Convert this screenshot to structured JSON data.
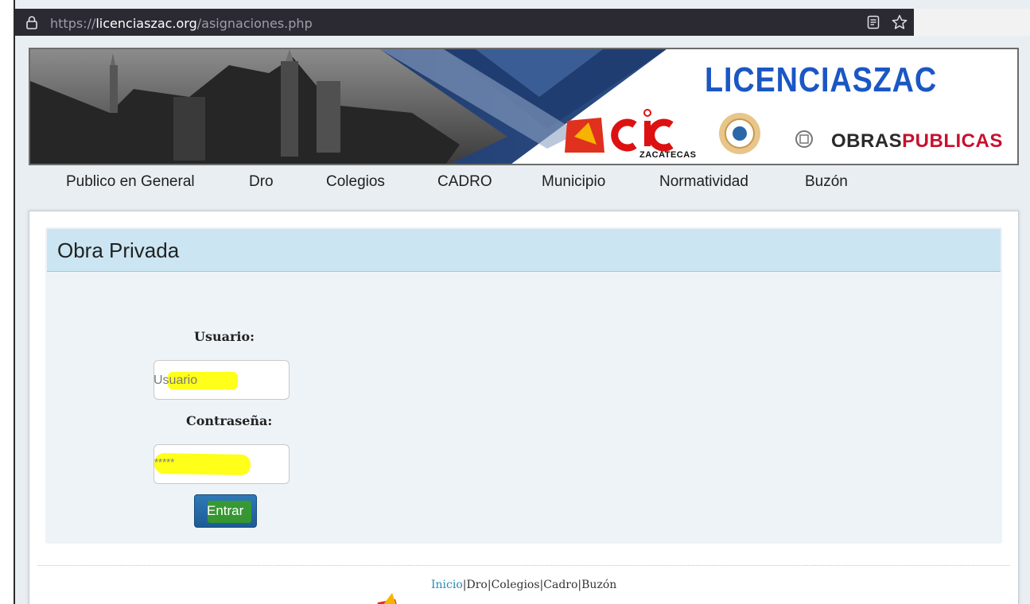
{
  "browser": {
    "url_protocol": "https://",
    "url_host": "licenciaszac.org",
    "url_path": "/asignaciones.php"
  },
  "banner": {
    "brand": "LICENCIASZAC",
    "zacatecas_label": "ZACATECAS",
    "obras_label_1": "OBRAS",
    "obras_label_2": "PUBLICAS"
  },
  "nav": {
    "items": [
      "Publico en General",
      "Dro",
      "Colegios",
      "CADRO",
      "Municipio",
      "Normatividad",
      "Buzón"
    ]
  },
  "panel": {
    "title": "Obra Privada"
  },
  "login": {
    "user_label": "Usuario:",
    "user_placeholder": "Usuario",
    "password_label": "Contraseña:",
    "password_placeholder": "*****",
    "submit_label": "Entrar"
  },
  "footer": {
    "links": [
      "Inicio",
      "Dro",
      "Colegios",
      "Cadro",
      "Buzón"
    ],
    "separator": "|"
  },
  "colors": {
    "brand_blue": "#1b57c4",
    "panel_header": "#cbe6f2",
    "button_blue": "#1d5b94",
    "highlight": "#ffff00"
  }
}
